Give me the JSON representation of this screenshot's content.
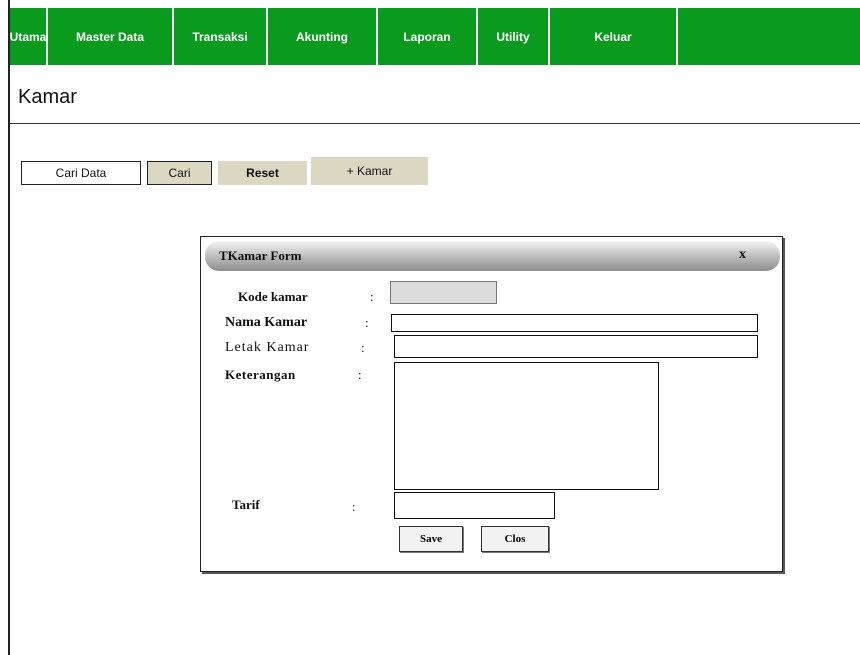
{
  "nav": {
    "items": [
      {
        "label": "Utama"
      },
      {
        "label": "Master Data"
      },
      {
        "label": "Transaksi"
      },
      {
        "label": "Akunting"
      },
      {
        "label": "Laporan"
      },
      {
        "label": "Utility"
      },
      {
        "label": "Keluar"
      }
    ]
  },
  "page": {
    "title": "Kamar"
  },
  "toolbar": {
    "search_label": "Cari Data",
    "search_button": "Cari",
    "reset_button": "Reset",
    "add_button": "+ Kamar"
  },
  "dialog": {
    "title": "TKamar Form",
    "close_label": "x",
    "fields": {
      "kode": {
        "label": "Kode kamar",
        "value": ""
      },
      "nama": {
        "label": "Nama Kamar",
        "value": ""
      },
      "letak": {
        "label": "Letak Kamar",
        "value": ""
      },
      "keterangan": {
        "label": "Keterangan",
        "value": ""
      },
      "tarif": {
        "label": "Tarif",
        "value": ""
      }
    },
    "colon": ":",
    "save_button": "Save",
    "close_button": "Clos"
  }
}
